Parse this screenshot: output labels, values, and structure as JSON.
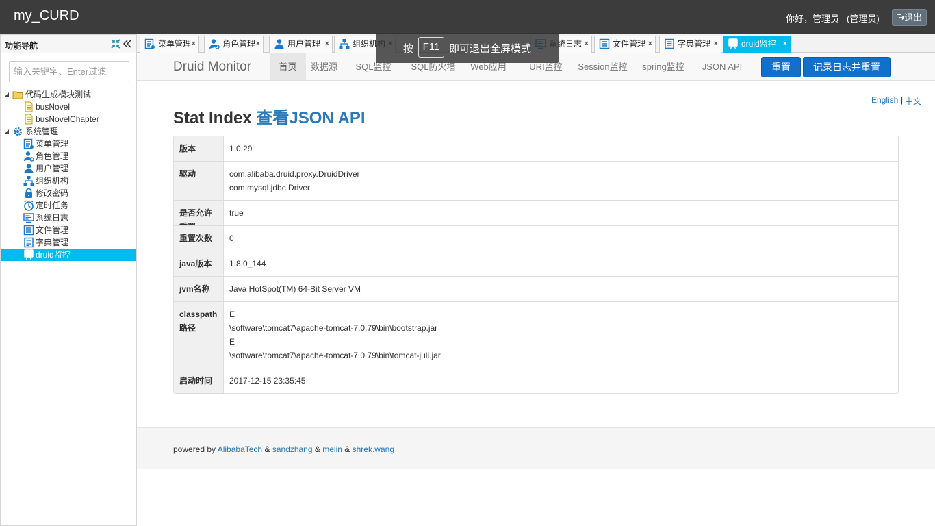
{
  "app": {
    "title": "my_CURD",
    "greeting": "你好，管理员",
    "role": "(管理员)",
    "logout": "退出"
  },
  "sidebar": {
    "title": "功能导航",
    "search_placeholder": "输入关键字、Enter过滤",
    "tree": [
      {
        "label": "代码生成模块测试",
        "icon": "folder-icon",
        "level": 0
      },
      {
        "label": "busNovel",
        "icon": "file-icon",
        "level": 1
      },
      {
        "label": "busNovelChapter",
        "icon": "file-icon",
        "level": 1
      },
      {
        "label": "系统管理",
        "icon": "gear-icon",
        "level": 0
      },
      {
        "label": "菜单管理",
        "icon": "menu-icon",
        "level": 1
      },
      {
        "label": "角色管理",
        "icon": "role-icon",
        "level": 1
      },
      {
        "label": "用户管理",
        "icon": "user-icon",
        "level": 1
      },
      {
        "label": "组织机构",
        "icon": "org-icon",
        "level": 1
      },
      {
        "label": "修改密码",
        "icon": "lock-icon",
        "level": 1
      },
      {
        "label": "定时任务",
        "icon": "clock-icon",
        "level": 1
      },
      {
        "label": "系统日志",
        "icon": "log-icon",
        "level": 1
      },
      {
        "label": "文件管理",
        "icon": "file-manage-icon",
        "level": 1
      },
      {
        "label": "字典管理",
        "icon": "dict-icon",
        "level": 1
      },
      {
        "label": "druid监控",
        "icon": "monitor-icon",
        "level": 1,
        "selected": true
      }
    ]
  },
  "tabs": [
    {
      "label": "菜单管理"
    },
    {
      "label": "角色管理"
    },
    {
      "label": "用户管理"
    },
    {
      "label": "组织机构"
    },
    {
      "label": "系统日志"
    },
    {
      "label": "文件管理"
    },
    {
      "label": "字典管理"
    },
    {
      "label": "druid监控",
      "active": true
    }
  ],
  "fullscreen_tip": {
    "before": "按",
    "key": "F11",
    "after": "即可退出全屏模式"
  },
  "druid": {
    "brand": "Druid Monitor",
    "nav": [
      "首页",
      "数据源",
      "SQL监控",
      "SQL防火墙",
      "Web应用",
      "URI监控",
      "Session监控",
      "spring监控",
      "JSON API"
    ],
    "reset": "重置",
    "log_reset": "记录日志并重置",
    "lang_en": "English",
    "lang_sep": "|",
    "lang_zh": "中文",
    "heading": "Stat Index",
    "heading_link": "查看JSON API",
    "stats": [
      {
        "key": "版本",
        "value": "1.0.29"
      },
      {
        "key": "驱动",
        "value": "com.alibaba.druid.proxy.DruidDriver\ncom.mysql.jdbc.Driver"
      },
      {
        "key": "是否允许重置",
        "value": "true"
      },
      {
        "key": "重置次数",
        "value": "0"
      },
      {
        "key": "java版本",
        "value": "1.8.0_144"
      },
      {
        "key": "jvm名称",
        "value": "Java HotSpot(TM) 64-Bit Server VM"
      },
      {
        "key": "classpath路径",
        "value": "E\n\\software\\tomcat7\\apache-tomcat-7.0.79\\bin\\bootstrap.jar\nE\n\\software\\tomcat7\\apache-tomcat-7.0.79\\bin\\tomcat-juli.jar"
      },
      {
        "key": "启动时间",
        "value": "2017-12-15 23:35:45"
      }
    ],
    "footer": {
      "prefix": "powered by",
      "amp": "&",
      "names": [
        "AlibabaTech",
        "sandzhang",
        "melin",
        "shrek.wang"
      ]
    }
  }
}
